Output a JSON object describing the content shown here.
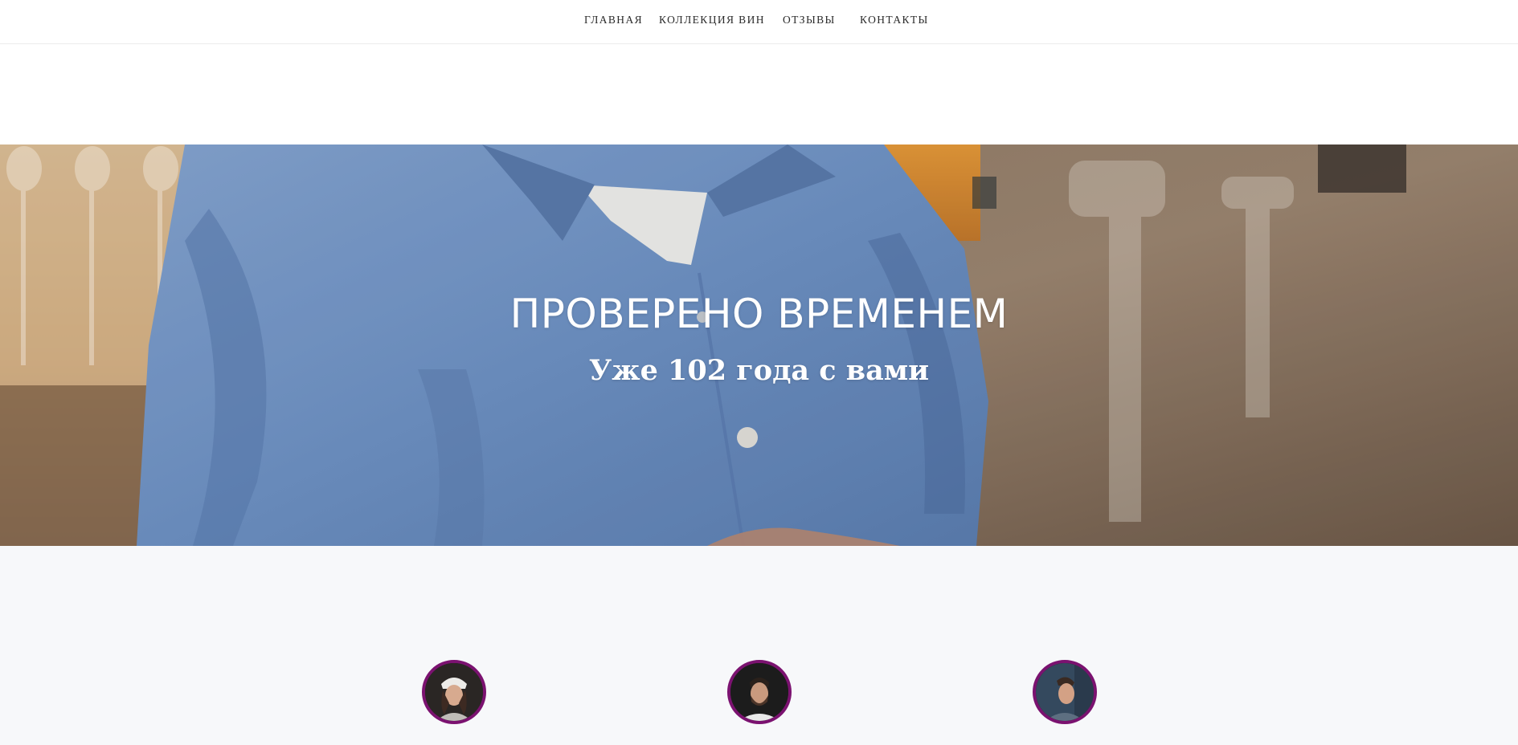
{
  "nav": {
    "items": [
      {
        "label": "ГЛАВНАЯ"
      },
      {
        "label": "КОЛЛЕКЦИЯ ВИН"
      },
      {
        "label": "ОТЗЫВЫ"
      },
      {
        "label": "КОНТАКТЫ"
      }
    ]
  },
  "hero": {
    "title": "ПРОВЕРЕНО ВРЕМЕНЕМ",
    "subtitle": "Уже 102 года с вами"
  },
  "testimonials": {
    "avatars": [
      {
        "icon": "woman-portrait"
      },
      {
        "icon": "man-bearded-portrait"
      },
      {
        "icon": "man-profile-portrait"
      }
    ]
  },
  "colors": {
    "avatar_border": "#7b1270",
    "section_bg": "#f7f8fa",
    "shirt_blue": "#6f93c6"
  }
}
